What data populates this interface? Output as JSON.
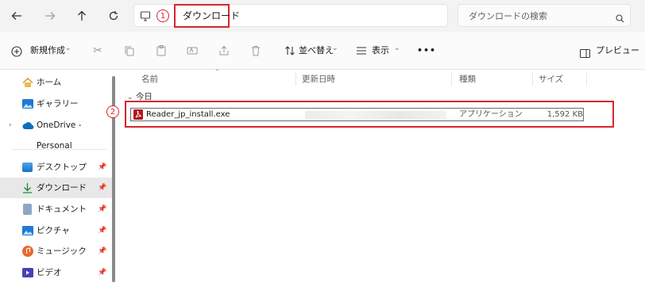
{
  "address": {
    "path": "ダウンロード",
    "callout": "1"
  },
  "search": {
    "placeholder": "ダウンロードの検索"
  },
  "toolbar": {
    "new_label": "新規作成",
    "sort_label": "並べ替え",
    "view_label": "表示",
    "more_label": "•••",
    "preview_label": "プレビュー"
  },
  "sidebar": {
    "items": [
      {
        "label": "ホーム",
        "icon": "home-icon"
      },
      {
        "label": "ギャラリー",
        "icon": "gallery-icon"
      },
      {
        "label": "OneDrive - Personal",
        "icon": "cloud-icon"
      },
      {
        "label": "デスクトップ",
        "icon": "desktop-icon",
        "pinned": true
      },
      {
        "label": "ダウンロード",
        "icon": "download-icon",
        "pinned": true,
        "active": true
      },
      {
        "label": "ドキュメント",
        "icon": "document-icon",
        "pinned": true
      },
      {
        "label": "ピクチャ",
        "icon": "picture-icon",
        "pinned": true
      },
      {
        "label": "ミュージック",
        "icon": "music-icon",
        "pinned": true
      },
      {
        "label": "ビデオ",
        "icon": "video-icon",
        "pinned": true
      }
    ]
  },
  "columns": {
    "name": "名前",
    "date": "更新日時",
    "type": "種類",
    "size": "サイズ"
  },
  "group": {
    "label": "今日"
  },
  "file": {
    "name": "Reader_jp_install.exe",
    "type": "アプリケーション",
    "size": "1,592 KB",
    "callout": "2"
  },
  "colors": {
    "callout": "#d7262e",
    "accent": "#0067c0"
  }
}
